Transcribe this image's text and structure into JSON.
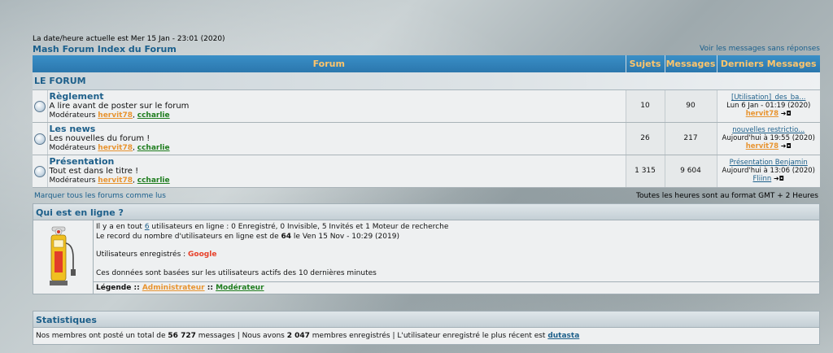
{
  "header": {
    "current_datetime": "La date/heure actuelle est Mer 15 Jan - 23:01 (2020)",
    "index_link": "Mash Forum Index du Forum",
    "unanswered_link": "Voir les messages sans réponses"
  },
  "table": {
    "columns": [
      "Forum",
      "Sujets",
      "Messages",
      "Derniers Messages"
    ],
    "category": "LE FORUM",
    "moderators_label": "Modérateurs",
    "forums": [
      {
        "name": "Règlement",
        "description": "A lire avant de poster sur le forum",
        "mod1": "hervit78",
        "mod2": "ccharlie",
        "topics": "10",
        "posts": "90",
        "last_title": "[Utilisation]_des_ba...",
        "last_date": "Lun 6 Jan - 01:19 (2020)",
        "last_user": "hervit78"
      },
      {
        "name": "Les news",
        "description": "Les nouvelles du forum !",
        "mod1": "hervit78",
        "mod2": "ccharlie",
        "topics": "26",
        "posts": "217",
        "last_title": "nouvelles restrictio...",
        "last_date": "Aujourd'hui à 19:55 (2020)",
        "last_user": "hervit78"
      },
      {
        "name": "Présentation",
        "description": "Tout est dans le titre !",
        "mod1": "hervit78",
        "mod2": "ccharlie",
        "topics": "1 315",
        "posts": "9 604",
        "last_title": "Présentation Benjamin",
        "last_date": "Aujourd'hui à 13:06 (2020)",
        "last_user": "Fliinn"
      }
    ],
    "mark_all": "Marquer tous les forums comme lus",
    "timezone": "Toutes les heures sont au format GMT + 2 Heures"
  },
  "who": {
    "title": "Qui est en ligne ?",
    "line1_pre": "Il y a en tout ",
    "line1_count": "6",
    "line1_post": " utilisateurs en ligne : 0 Enregistré, 0 Invisible, 5 Invités et 1 Moteur de recherche",
    "line2_pre": "Le record du nombre d'utilisateurs en ligne est de ",
    "line2_count": "64",
    "line2_post": " le Ven 15 Nov - 10:29 (2019)",
    "registered_label": "Utilisateurs enregistrés : ",
    "registered_value": "Google",
    "info": "Ces données sont basées sur les utilisateurs actifs des 10 dernières minutes",
    "legend_label": "Légende :: ",
    "legend_admin": "Administrateur",
    "legend_sep": " :: ",
    "legend_mod": "Modérateur"
  },
  "stats": {
    "title": "Statistiques",
    "pre": "Nos membres ont posté un total de ",
    "posts": "56 727",
    "mid": " messages | Nous avons ",
    "members": "2 047",
    "mid2": " membres enregistrés | L'utilisateur enregistré le plus récent est ",
    "newest": "dutasta"
  },
  "colors": {
    "header_blue": "#2b77ad",
    "header_text": "#ffc56b",
    "link_blue": "#1d5f8a",
    "admin_orange": "#e89430",
    "mod_green": "#1e7d1e"
  }
}
